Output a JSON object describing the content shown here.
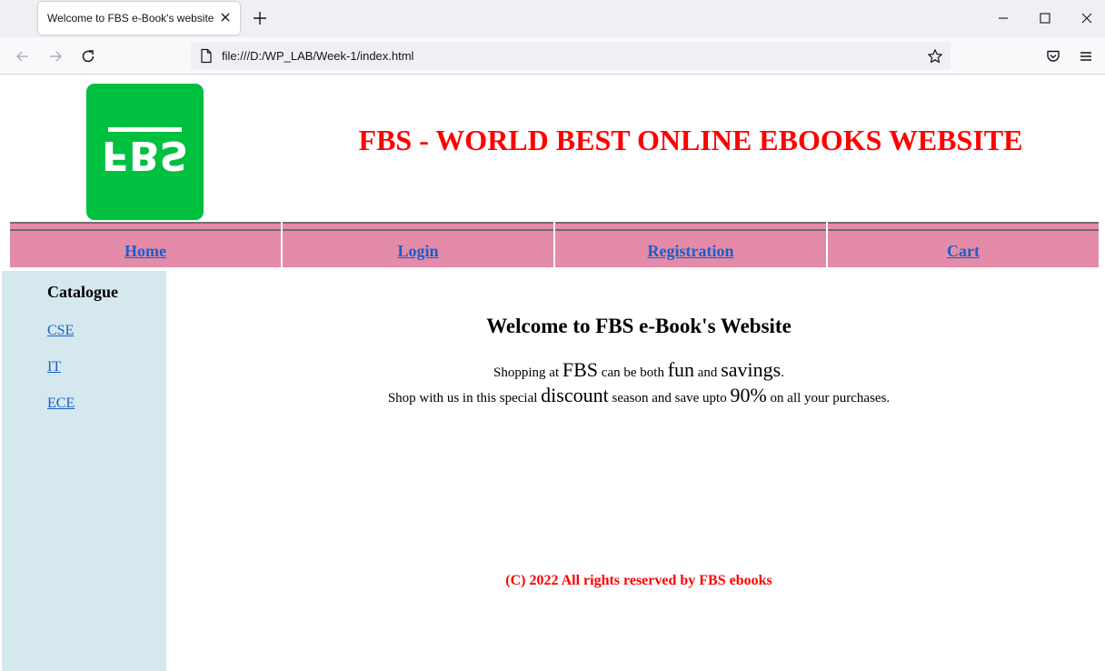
{
  "browser": {
    "tab_title": "Welcome to FBS e-Book's website",
    "url": "file:///D:/WP_LAB/Week-1/index.html",
    "icons": {
      "tab_close": "close-icon",
      "new_tab": "plus-icon",
      "minimize": "minimize-icon",
      "maximize": "maximize-icon",
      "close_window": "close-icon",
      "back": "arrow-left-icon",
      "forward": "arrow-right-icon",
      "reload": "reload-icon",
      "page": "page-icon",
      "bookmark": "star-icon",
      "pocket": "pocket-icon",
      "menu": "hamburger-icon"
    }
  },
  "header": {
    "logo_text": "FBS",
    "title": "FBS - WORLD BEST ONLINE EBOOKS WEBSITE",
    "title_color": "#ff0000",
    "logo_color": "#00c040"
  },
  "menu": {
    "background": "#e38ba9",
    "items": [
      {
        "label": "Home"
      },
      {
        "label": "Login"
      },
      {
        "label": "Registration"
      },
      {
        "label": "Cart"
      }
    ]
  },
  "sidebar": {
    "title": "Catalogue",
    "background": "#d5e8ee",
    "links": [
      {
        "label": "CSE"
      },
      {
        "label": "IT"
      },
      {
        "label": "ECE"
      }
    ]
  },
  "main": {
    "heading": "Welcome to FBS e-Book's Website",
    "line1": {
      "a": "Shopping at ",
      "b": "FBS",
      "c": " can be both ",
      "d": "fun",
      "e": " and ",
      "f": "savings",
      "g": "."
    },
    "line2": {
      "a": "Shop with us in this special ",
      "b": "discount",
      "c": " season and save upto ",
      "d": "90%",
      "e": " on all your purchases."
    },
    "footer": "(C) 2022 All rights reserved by FBS ebooks"
  }
}
